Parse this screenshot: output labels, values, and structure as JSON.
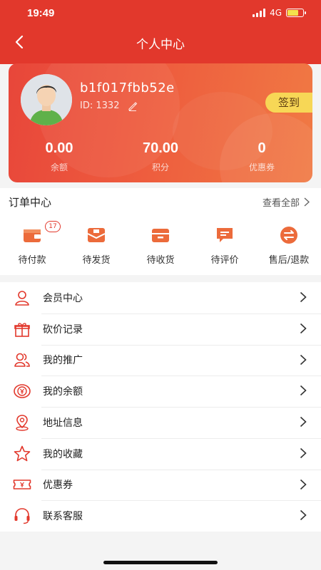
{
  "status": {
    "time": "19:49",
    "network": "4G"
  },
  "nav": {
    "title": "个人中心"
  },
  "profile": {
    "username": "b1f017fbb52e",
    "id_label": "ID:",
    "id_value": "1332",
    "signin_label": "签到",
    "stats": [
      {
        "value": "0.00",
        "label": "余额"
      },
      {
        "value": "70.00",
        "label": "积分"
      },
      {
        "value": "0",
        "label": "优惠券"
      }
    ]
  },
  "orders": {
    "title": "订单中心",
    "view_all": "查看全部",
    "items": [
      {
        "label": "待付款",
        "icon": "wallet-icon",
        "badge": "17"
      },
      {
        "label": "待发货",
        "icon": "package-icon"
      },
      {
        "label": "待收货",
        "icon": "box-icon"
      },
      {
        "label": "待评价",
        "icon": "comment-icon"
      },
      {
        "label": "售后/退款",
        "icon": "refund-icon"
      }
    ]
  },
  "menu": {
    "items": [
      {
        "label": "会员中心",
        "icon": "member-icon"
      },
      {
        "label": "砍价记录",
        "icon": "gift-icon"
      },
      {
        "label": "我的推广",
        "icon": "users-icon"
      },
      {
        "label": "我的余额",
        "icon": "yen-coin-icon"
      },
      {
        "label": "地址信息",
        "icon": "location-icon"
      },
      {
        "label": "我的收藏",
        "icon": "star-icon"
      },
      {
        "label": "优惠券",
        "icon": "coupon-icon"
      },
      {
        "label": "联系客服",
        "icon": "headset-icon"
      }
    ]
  },
  "colors": {
    "brand": "#e2382c",
    "accent": "#f0713a",
    "signin_bg": "#f7d756"
  }
}
